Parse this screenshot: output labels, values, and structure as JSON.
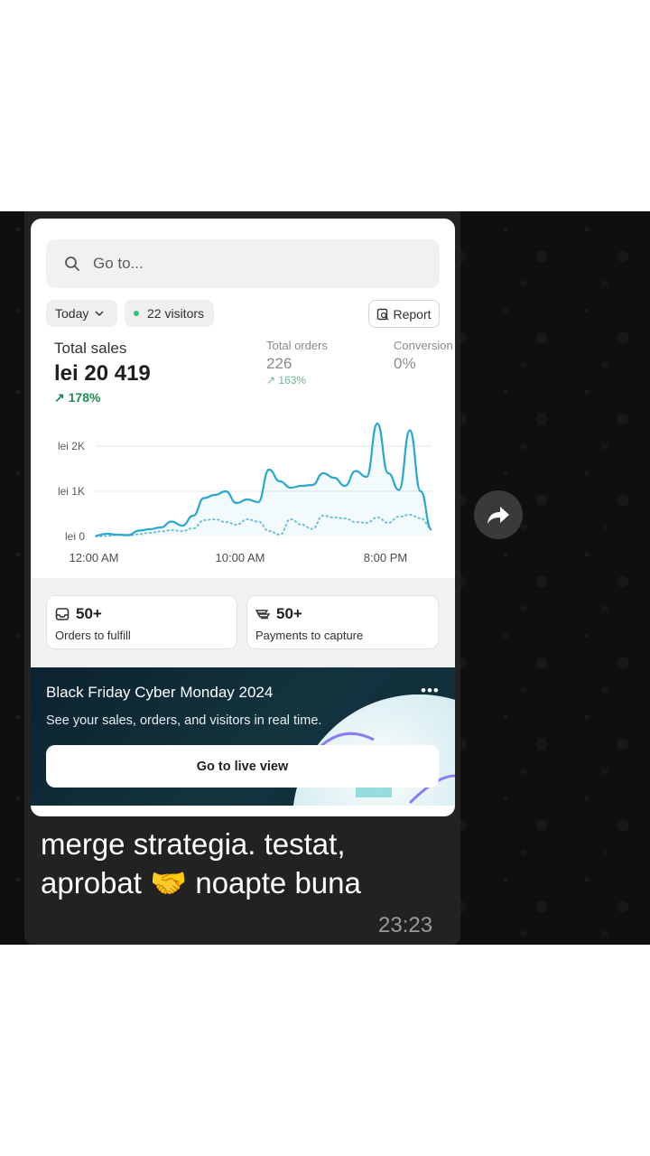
{
  "colors": {
    "chat_background": "#0f0f0f",
    "bubble": "#222222",
    "accent_line": "#2aa6cf",
    "positive_change": "#1e8a55",
    "promo_background": "#0c2230"
  },
  "dashboard": {
    "search": {
      "placeholder": "Go to...",
      "icon": "search-icon"
    },
    "filters": {
      "date_range": "Today",
      "visitors": "22 visitors",
      "report_button": "Report"
    },
    "metrics": {
      "total_sales_label": "Total sales",
      "total_sales_value": "lei 20 419",
      "total_sales_change": "178%",
      "total_orders_label": "Total orders",
      "total_orders_value": "226",
      "total_orders_change": "163%",
      "conversion_label": "Conversion",
      "conversion_value": "0%"
    },
    "tiles": [
      {
        "value": "50+",
        "label": "Orders to fulfill",
        "icon": "inbox-icon"
      },
      {
        "value": "50+",
        "label": "Payments to capture",
        "icon": "cash-icon"
      }
    ],
    "promo": {
      "title": "Black Friday Cyber Monday 2024",
      "subtitle": "See your sales, orders, and visitors in real time.",
      "button": "Go to live view",
      "more": "•••"
    }
  },
  "chart_data": {
    "type": "line",
    "y_ticks": [
      "lei 2K",
      "lei 1K",
      "lei 0"
    ],
    "x_ticks": [
      "12:00 AM",
      "10:00 AM",
      "8:00 PM"
    ],
    "ylim": [
      0,
      2500
    ],
    "grid": true,
    "series": [
      {
        "values": [
          20,
          60,
          40,
          30,
          130,
          160,
          200,
          330,
          240,
          460,
          850,
          920,
          1000,
          740,
          820,
          760,
          1480,
          1220,
          1080,
          1120,
          1140,
          1400,
          1300,
          1120,
          1450,
          1320,
          2500,
          1400,
          1030,
          2350,
          1000,
          150
        ]
      },
      {
        "values": [
          0,
          10,
          30,
          20,
          50,
          80,
          110,
          140,
          120,
          180,
          360,
          380,
          320,
          260,
          380,
          330,
          120,
          40,
          380,
          260,
          170,
          460,
          420,
          400,
          320,
          300,
          420,
          300,
          440,
          480,
          400,
          190
        ]
      }
    ]
  },
  "chat": {
    "message_line1": "merge strategia. testat,",
    "message_line2": "aprobat 🤝 noapte buna",
    "time": "23:23",
    "forward_icon": "forward-arrow-icon"
  }
}
